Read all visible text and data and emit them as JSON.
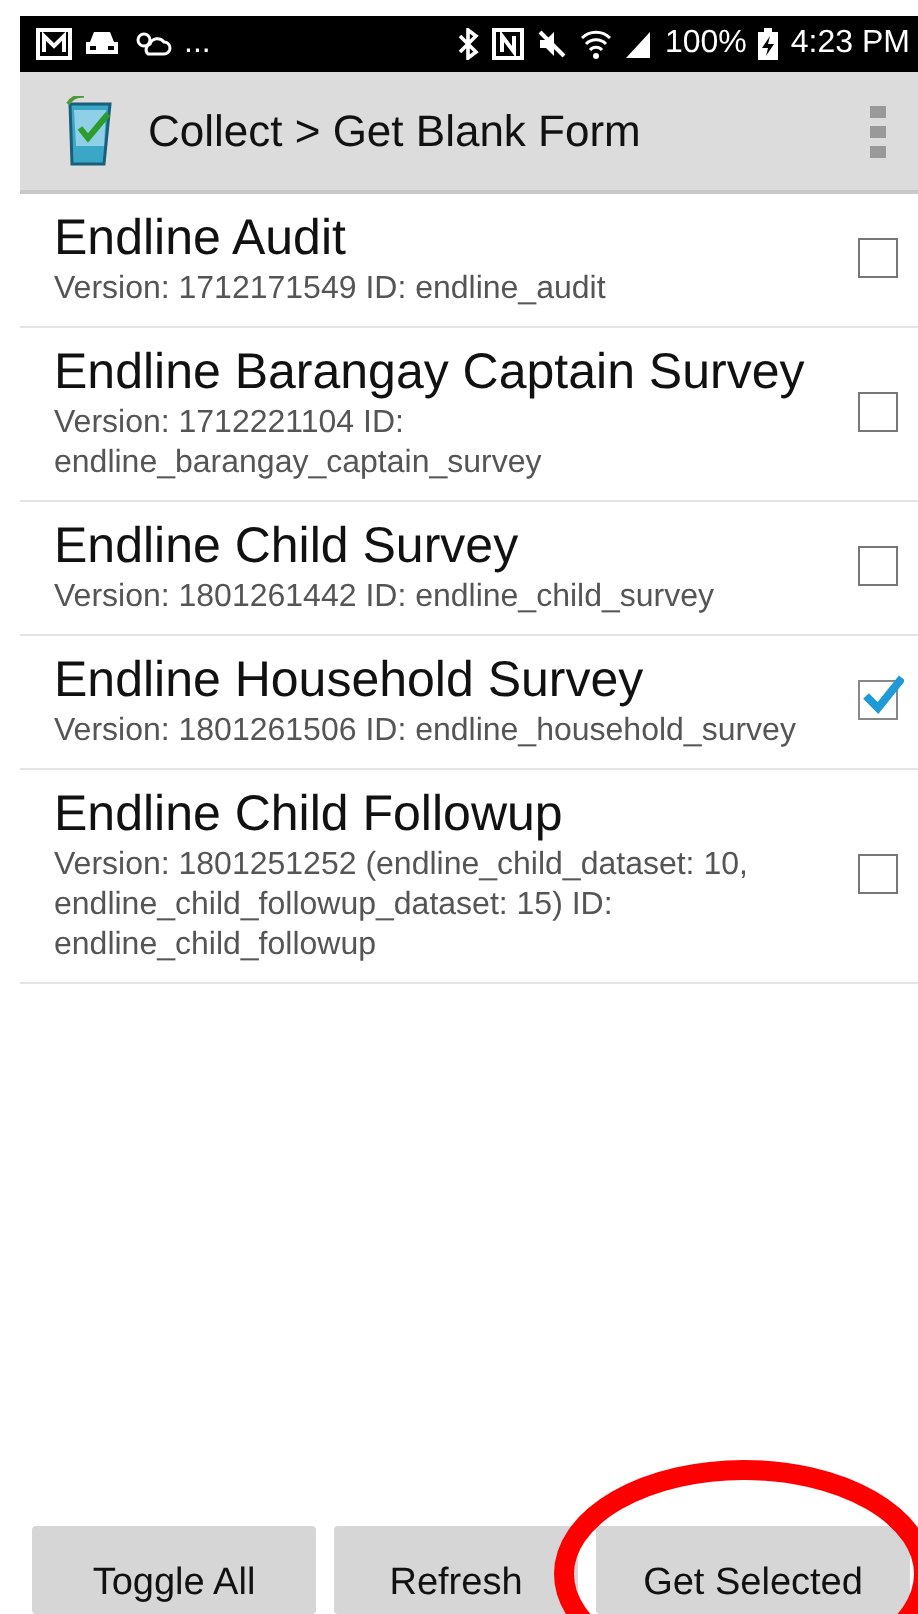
{
  "status_bar": {
    "overflow": "...",
    "battery": "100%",
    "time": "4:23 PM"
  },
  "app_bar": {
    "title": "Collect > Get Blank Form"
  },
  "forms": [
    {
      "title": "Endline Audit",
      "details": "Version: 1712171549 ID: endline_audit",
      "checked": false
    },
    {
      "title": "Endline Barangay Captain Survey",
      "details": "Version: 1712221104 ID: endline_barangay_captain_survey",
      "checked": false
    },
    {
      "title": "Endline Child Survey",
      "details": "Version: 1801261442 ID: endline_child_survey",
      "checked": false
    },
    {
      "title": "Endline Household Survey",
      "details": "Version: 1801261506 ID: endline_household_survey",
      "checked": true
    },
    {
      "title": "Endline Child Followup",
      "details": "Version: 1801251252 (endline_child_dataset: 10, endline_child_followup_dataset: 15) ID: endline_child_followup",
      "checked": false
    }
  ],
  "buttons": [
    {
      "label": "Toggle All",
      "circled": false
    },
    {
      "label": "Refresh",
      "circled": false
    },
    {
      "label": "Get Selected",
      "circled": true
    }
  ]
}
